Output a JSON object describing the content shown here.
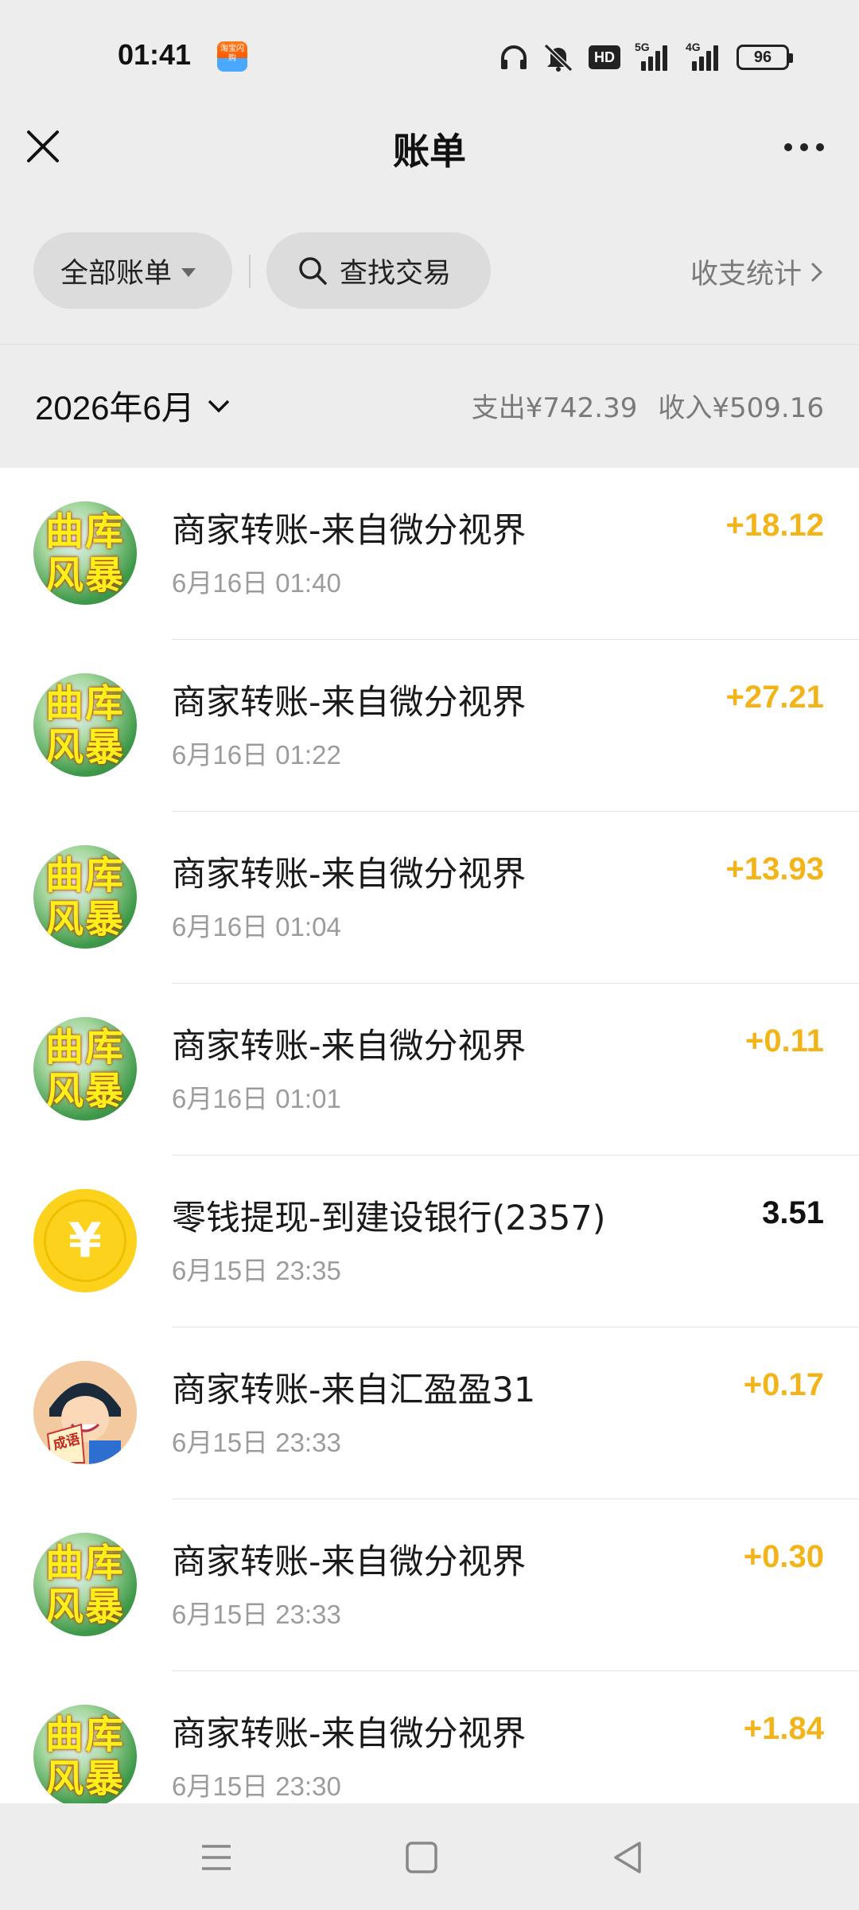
{
  "status_bar": {
    "time": "01:41",
    "app_badge_text": "淘宝闪购",
    "network_5g": "5G",
    "network_4g": "4G",
    "hd_label": "HD",
    "battery": "96"
  },
  "header": {
    "title": "账单"
  },
  "filters": {
    "all_bills": "全部账单",
    "search": "查找交易",
    "stats": "收支统计"
  },
  "month": {
    "label": "2026年6月",
    "expense": "支出¥742.39",
    "income": "收入¥509.16"
  },
  "transactions": [
    {
      "title": "商家转账-来自微分视界",
      "date": "6月16日 01:40",
      "amount": "+18.12",
      "type": "income",
      "avatar": "storm"
    },
    {
      "title": "商家转账-来自微分视界",
      "date": "6月16日 01:22",
      "amount": "+27.21",
      "type": "income",
      "avatar": "storm"
    },
    {
      "title": "商家转账-来自微分视界",
      "date": "6月16日 01:04",
      "amount": "+13.93",
      "type": "income",
      "avatar": "storm"
    },
    {
      "title": "商家转账-来自微分视界",
      "date": "6月16日 01:01",
      "amount": "+0.11",
      "type": "income",
      "avatar": "storm"
    },
    {
      "title": "零钱提现-到建设银行(2357)",
      "date": "6月15日 23:35",
      "amount": "3.51",
      "type": "expense",
      "avatar": "coin"
    },
    {
      "title": "商家转账-来自汇盈盈31",
      "date": "6月15日 23:33",
      "amount": "+0.17",
      "type": "income",
      "avatar": "idiom"
    },
    {
      "title": "商家转账-来自微分视界",
      "date": "6月15日 23:33",
      "amount": "+0.30",
      "type": "income",
      "avatar": "storm"
    },
    {
      "title": "商家转账-来自微分视界",
      "date": "6月15日 23:30",
      "amount": "+1.84",
      "type": "income",
      "avatar": "storm"
    }
  ],
  "avatar_text": {
    "storm_line1": "曲库",
    "storm_line2": "风暴",
    "coin_symbol": "¥",
    "idiom_label": "成语"
  },
  "colors": {
    "income": "#f2b418",
    "expense": "#111111",
    "background": "#ededed"
  }
}
